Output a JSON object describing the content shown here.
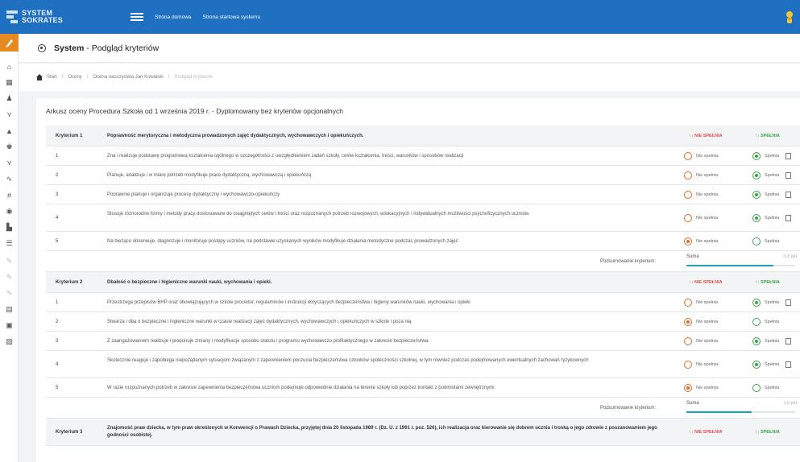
{
  "app": {
    "logo_line1": "SYSTEM",
    "logo_line2": "SOKRATES",
    "nav_links": [
      "Strona domowa",
      "Strona startowa systemu"
    ]
  },
  "page": {
    "title_bold": "System",
    "title_rest": " - Podgląd kryteriów"
  },
  "breadcrumb": [
    "Start",
    "Oceny",
    "Ocena nauczyciela Jan Kowalski",
    "Podgląd kryteriów"
  ],
  "sheet_title": "Arkusz oceny Procedura Szkoła od 1 września 2019 r. - Dyplomowany bez kryteriów opcjonalnych",
  "labels": {
    "not_meets_header": "NIE SPEŁNIA",
    "meets_header": "SPEŁNIA",
    "not_meets_option": "Nie spełnia",
    "meets_option": "Spełnia",
    "summary_label": "Podsumowanie kryterium:",
    "sum_text": "Suma"
  },
  "criteria": [
    {
      "name": "Kryterium 1",
      "title": "Poprawność merytoryczna i metodyczna prowadzonych zajęć dydaktycznych, wychowawczych i opiekuńczych.",
      "items": [
        {
          "num": "1",
          "text": "Zna i realizuje podstawę programową kształcenia ogólnego w szczególności z uwzględnieniem zadań szkoły, celów kształcenia, treści, warunków i sposobów realizacji",
          "selected": "yes",
          "note": true
        },
        {
          "num": "2",
          "text": "Planuje, analizuje i w miarę potrzeb modyfikuje prace dydaktyczną, wychowawczą i opiekuńczą",
          "selected": "yes",
          "note": true
        },
        {
          "num": "3",
          "text": "Poprawnie planuje i organizuje procesy dydaktyczny i wychowawczo-opiekuńczy",
          "selected": "yes",
          "note": true
        },
        {
          "num": "4",
          "text": "Stosuje różnorodne formy i metody pracy dostosowane do osiągniętych celów i treści oraz rozpoznanych potrzeb rozwojowych, edukacyjnych i indywidualnych możliwości psychofizycznych uczniów.",
          "selected": "yes",
          "note": true
        },
        {
          "num": "5",
          "text": "Na bieżąco obserwuje, diagnozuje i monitoruje postępy uczniów, na podstawie uzyskanych wyników modyfikuje działania metodyczne podczas prowadzonych zajęć",
          "selected": "no",
          "note": false
        }
      ],
      "sum_value": "0,8 pkt",
      "progress": 0.8
    },
    {
      "name": "Kryterium 2",
      "title": "Dbałość o bezpieczne i higieniczne warunki nauki, wychowania i opieki.",
      "items": [
        {
          "num": "1",
          "text": "Przestrzega przepisów BHP oraz obowiązujących w szkole procedur, regulaminów i instrukcji dotyczących bezpieczeństwa i higieny warunków nauki, wychowania i opieki",
          "selected": "yes",
          "note": true
        },
        {
          "num": "2",
          "text": "Stwarza i dba o bezpieczne i higieniczne warunki w czasie realizacji zajęć dydaktycznych, wychowawczych i opiekuńczych w szkole i poza nią",
          "selected": "no",
          "note": false
        },
        {
          "num": "3",
          "text": "Z zaangażowaniem realizuje i proponuje zmiany i modyfikacje sposobu statutu i programu wychowawczo profilaktycznego w zakresie bezpieczeństwa.",
          "selected": "yes",
          "note": true
        },
        {
          "num": "4",
          "text": "Skutecznie reaguje i zapobiega niepożądanym sytuacjom związanym z zapewnieniem poczucia bezpieczeństwa członków społeczności szkolnej, w tym również podczas podejmowanych ewentualnych zachowań ryzykownych",
          "selected": "yes",
          "note": true
        },
        {
          "num": "5",
          "text": "W razie rozpoznanych potrzeb w zakresie zapewnienia bezpieczeństwa uczniom podejmuje odpowiednie działania na terenie szkoły lub poprzez kontakt z podmiotami zewnętrznymi",
          "selected": "no",
          "note": false
        }
      ],
      "sum_value": "1,6 pkt",
      "progress": 0.6
    },
    {
      "name": "Kryterium 3",
      "title": "Znajomość praw dziecka, w tym praw określonych w Konwencji o Prawach Dziecka, przyjętej dnia 20 listopada 1989 r. (Dz. U. z 1991 r. poz. 526), ich realizacja oraz kierowanie się dobrem ucznia i troską o jego zdrowie z poszanowaniem jego godności osobistej.",
      "items": []
    }
  ],
  "colors": {
    "topbar": "#1e6fbf",
    "accent": "#e58a1f",
    "not_meets": "#e36a28",
    "meets": "#3aa34a",
    "progress": "#1aa3c8"
  }
}
